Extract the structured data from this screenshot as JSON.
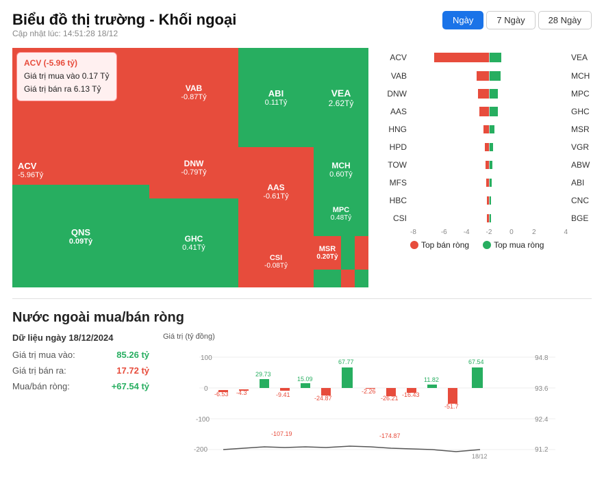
{
  "header": {
    "title": "Biểu đồ thị trường - Khối ngoại",
    "subtitle": "Cập nhật lúc: 14:51:28 18/12",
    "buttons": [
      "Ngày",
      "7 Ngày",
      "28 Ngày"
    ],
    "active_button": "Ngày"
  },
  "tooltip": {
    "title": "ACV (-5.96 tỷ)",
    "line1": "Giá trị mua vào 0.17 Tỷ",
    "line2": "Giá trị bán ra 6.13 Tỷ"
  },
  "treemap": {
    "cells": [
      {
        "id": "acv",
        "label": "ACV",
        "value": "-5.96Tỷ",
        "color": "red"
      },
      {
        "id": "qns",
        "label": "QNS",
        "value": "0.09Tỷ",
        "color": "green"
      },
      {
        "id": "vab",
        "label": "VAB",
        "value": "-0.87Tỷ",
        "color": "red"
      },
      {
        "id": "dnw",
        "label": "DNW",
        "value": "-0.79Tỷ",
        "color": "red"
      },
      {
        "id": "ghc",
        "label": "GHC",
        "value": "0.41Tỷ",
        "color": "green"
      },
      {
        "id": "abi",
        "label": "ABI",
        "value": "0.11Tỷ",
        "color": "green"
      },
      {
        "id": "vea",
        "label": "VEA",
        "value": "2.62Tỷ",
        "color": "green"
      },
      {
        "id": "aas",
        "label": "AAS",
        "value": "-0.61Tỷ",
        "color": "red"
      },
      {
        "id": "mch",
        "label": "MCH",
        "value": "0.60Tỷ",
        "color": "green"
      },
      {
        "id": "mpc",
        "label": "MPC",
        "value": "0.48Tỷ",
        "color": "green"
      },
      {
        "id": "csi",
        "label": "CSI",
        "value": "-0.08Tỷ",
        "color": "red"
      },
      {
        "id": "msr",
        "label": "MSR",
        "value": "0.20Tỷ",
        "color": "red"
      }
    ]
  },
  "barchart": {
    "rows": [
      {
        "left": "ACV",
        "right": "VEA",
        "red_width": 85,
        "green_width": 20
      },
      {
        "left": "VAB",
        "right": "MCH",
        "red_width": 20,
        "green_width": 20
      },
      {
        "left": "DNW",
        "right": "MPC",
        "red_width": 18,
        "green_width": 14
      },
      {
        "left": "AAS",
        "right": "GHC",
        "red_width": 16,
        "green_width": 14
      },
      {
        "left": "HNG",
        "right": "MSR",
        "red_width": 8,
        "green_width": 8
      },
      {
        "left": "HPD",
        "right": "VGR",
        "red_width": 6,
        "green_width": 6
      },
      {
        "left": "TOW",
        "right": "ABW",
        "red_width": 5,
        "green_width": 5
      },
      {
        "left": "MFS",
        "right": "ABI",
        "red_width": 4,
        "green_width": 4
      },
      {
        "left": "HBC",
        "right": "CNC",
        "red_width": 3,
        "green_width": 3
      },
      {
        "left": "CSI",
        "right": "BGE",
        "red_width": 3,
        "green_width": 3
      }
    ],
    "x_labels": [
      "-8",
      "-6",
      "-4",
      "-2",
      "0",
      "2",
      "4"
    ],
    "legend_sell": "Top bán ròng",
    "legend_buy": "Top mua ròng"
  },
  "bottom_section": {
    "title": "Nước ngoài mua/bán ròng",
    "data_date": "Dữ liệu ngày 18/12/2024",
    "rows": [
      {
        "label": "Giá trị mua vào:",
        "value": "85.26 tỷ",
        "color": "green"
      },
      {
        "label": "Giá trị bán ra:",
        "value": "17.72 tỷ",
        "color": "red"
      },
      {
        "label": "Mua/bán ròng:",
        "value": "+67.54 tỷ",
        "color": "green"
      }
    ],
    "chart": {
      "y_title": "Giá trị (tỷ đồng)",
      "bars": [
        {
          "x": 0,
          "label": "-6.53",
          "value": -6.53,
          "color": "red"
        },
        {
          "x": 1,
          "label": "-4.3",
          "value": -4.3,
          "color": "red"
        },
        {
          "x": 2,
          "label": "29.73",
          "value": 29.73,
          "color": "green"
        },
        {
          "x": 3,
          "label": "-9.41",
          "value": -9.41,
          "color": "red"
        },
        {
          "x": 4,
          "label": "15.09",
          "value": 15.09,
          "color": "green"
        },
        {
          "x": 5,
          "label": "-24.87",
          "value": -24.87,
          "color": "red"
        },
        {
          "x": 6,
          "label": "67.77",
          "value": 67.77,
          "color": "green"
        },
        {
          "x": 7,
          "label": "-2.26",
          "value": -2.26,
          "color": "red"
        },
        {
          "x": 8,
          "label": "-26.21",
          "value": -26.21,
          "color": "red"
        },
        {
          "x": 9,
          "label": "-16.43",
          "value": -16.43,
          "color": "red"
        },
        {
          "x": 10,
          "label": "11.82",
          "value": 11.82,
          "color": "green"
        },
        {
          "x": 11,
          "label": "-51.7",
          "value": -51.7,
          "color": "red"
        },
        {
          "x": 12,
          "label": "67.54",
          "value": 67.54,
          "color": "green"
        }
      ],
      "line_points": "-107.19 -174.87",
      "y_right_labels": [
        "94.8",
        "93.6",
        "92.4",
        "91.2"
      ],
      "y_left_labels": [
        "100",
        "0",
        "-100",
        "-200"
      ],
      "x_label_bottom": "18/12"
    }
  }
}
